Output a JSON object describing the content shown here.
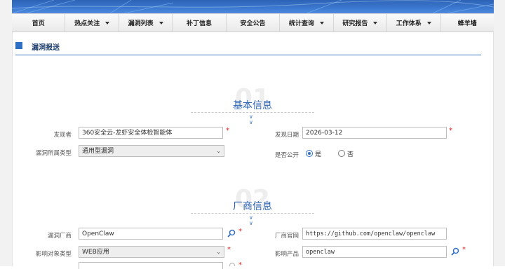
{
  "nav": [
    {
      "label": "首页",
      "dropdown": false
    },
    {
      "label": "热点关注",
      "dropdown": true
    },
    {
      "label": "漏洞列表",
      "dropdown": true
    },
    {
      "label": "补丁信息",
      "dropdown": false
    },
    {
      "label": "安全公告",
      "dropdown": false
    },
    {
      "label": "统计查询",
      "dropdown": true
    },
    {
      "label": "研究报告",
      "dropdown": true
    },
    {
      "label": "工作体系",
      "dropdown": true
    },
    {
      "label": "蜂羊墙",
      "dropdown": false
    }
  ],
  "page": {
    "title": "漏洞报送"
  },
  "section1": {
    "number": "01",
    "title": "基本信息",
    "discoverer_label": "发现者",
    "discoverer_value": "360安全云-龙虾安全体检智能体",
    "date_label": "发现日期",
    "date_value": "2026-03-12",
    "type_label": "漏洞所属类型",
    "type_value": "通用型漏洞",
    "public_label": "是否公开",
    "public_yes": "是",
    "public_no": "否",
    "public_selected": "是"
  },
  "section2": {
    "number": "02",
    "title": "厂商信息",
    "vendor_label": "漏洞厂商",
    "vendor_value": "OpenClaw",
    "website_label": "厂商官网",
    "website_value": "https://github.com/openclaw/openclaw",
    "target_type_label": "影响对象类型",
    "target_type_value": "WEB应用",
    "product_label": "影响产品",
    "product_value": "openclaw"
  },
  "required_mark": "*",
  "icons": {
    "search": "magnifier-icon",
    "dropdown": "caret-down-icon",
    "collapse": "double-chevron-down-icon"
  },
  "colors": {
    "accent": "#2d65b5",
    "required": "#e02020",
    "banner": "#3b78cf"
  }
}
